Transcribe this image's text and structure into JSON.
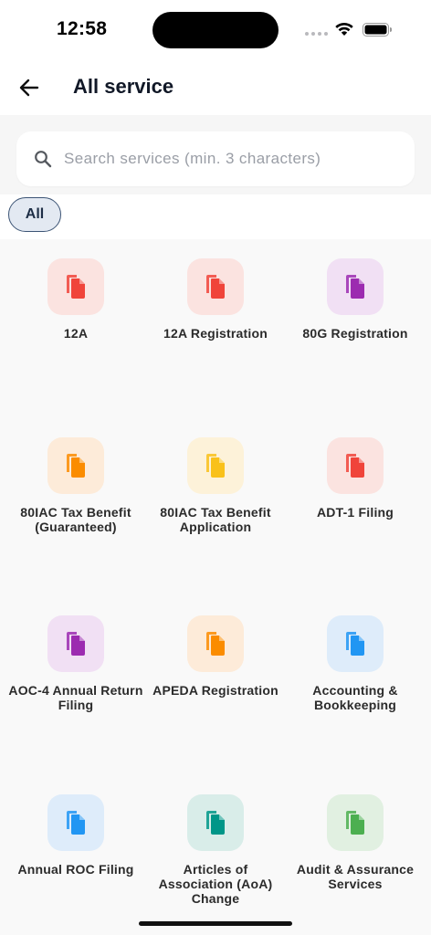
{
  "status_bar": {
    "time": "12:58"
  },
  "header": {
    "title": "All service"
  },
  "search": {
    "placeholder": "Search services (min. 3 characters)",
    "value": ""
  },
  "filters": [
    {
      "label": "All",
      "selected": true
    }
  ],
  "services": [
    {
      "label": "12A",
      "icon": "document-copy-icon",
      "color": "#f0443a",
      "bg": "#fbe3e0"
    },
    {
      "label": "12A Registration",
      "icon": "document-copy-icon",
      "color": "#f0443a",
      "bg": "#fbe3e0"
    },
    {
      "label": "80G Registration",
      "icon": "document-copy-icon",
      "color": "#9c2bb0",
      "bg": "#f1e0f4"
    },
    {
      "label": "80IAC Tax Benefit (Guaranteed)",
      "icon": "document-copy-icon",
      "color": "#fb8c00",
      "bg": "#fdebd9"
    },
    {
      "label": "80IAC Tax Benefit Application",
      "icon": "document-copy-icon",
      "color": "#f9c11a",
      "bg": "#fdf2d9"
    },
    {
      "label": "ADT-1 Filing",
      "icon": "document-copy-icon",
      "color": "#f0443a",
      "bg": "#fbe3e0"
    },
    {
      "label": "AOC-4 Annual Return Filing",
      "icon": "document-copy-icon",
      "color": "#9c2bb0",
      "bg": "#f1e0f4"
    },
    {
      "label": "APEDA Registration",
      "icon": "document-copy-icon",
      "color": "#fb8c00",
      "bg": "#fdebd9"
    },
    {
      "label": "Accounting & Bookkeeping",
      "icon": "document-copy-icon",
      "color": "#2196f3",
      "bg": "#deecfa"
    },
    {
      "label": "Annual ROC Filing",
      "icon": "document-copy-icon",
      "color": "#2196f3",
      "bg": "#deecfa"
    },
    {
      "label": "Articles of Association (AoA) Change",
      "icon": "document-copy-icon",
      "color": "#009688",
      "bg": "#d9ede9"
    },
    {
      "label": "Audit & Assurance Services",
      "icon": "document-copy-icon",
      "color": "#4caf50",
      "bg": "#e1f0e1"
    }
  ]
}
